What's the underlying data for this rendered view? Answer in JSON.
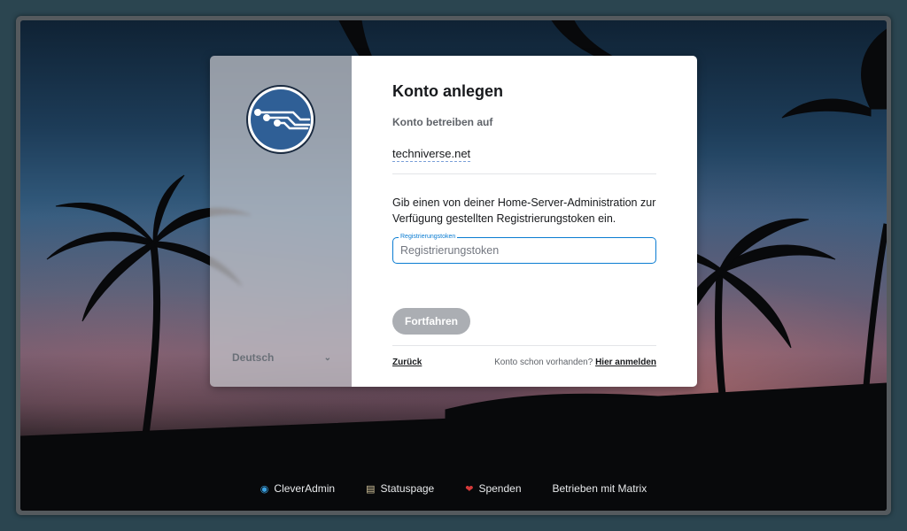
{
  "register": {
    "title": "Konto anlegen",
    "host_label": "Konto betreiben auf",
    "host_value": "techniverse.net",
    "description": "Gib einen von deiner Home-Server-Administration zur Verfügung gestellten Registrierungstoken ein.",
    "token_field_label": "Registrierungstoken",
    "token_placeholder": "Registrierungstoken",
    "continue_label": "Fortfahren",
    "back_label": "Zurück",
    "have_account_text": "Konto schon vorhanden?",
    "login_link": "Hier anmelden"
  },
  "language": {
    "selected": "Deutsch"
  },
  "footer": {
    "links": [
      {
        "label": "CleverAdmin",
        "icon": "globe-icon"
      },
      {
        "label": "Statuspage",
        "icon": "chart-icon"
      },
      {
        "label": "Spenden",
        "icon": "heart-icon"
      },
      {
        "label": "Betrieben mit Matrix",
        "icon": ""
      }
    ]
  },
  "colors": {
    "accent": "#0a7cd2",
    "button_disabled": "#abaeb3",
    "logo_blue": "#2f5f96"
  }
}
